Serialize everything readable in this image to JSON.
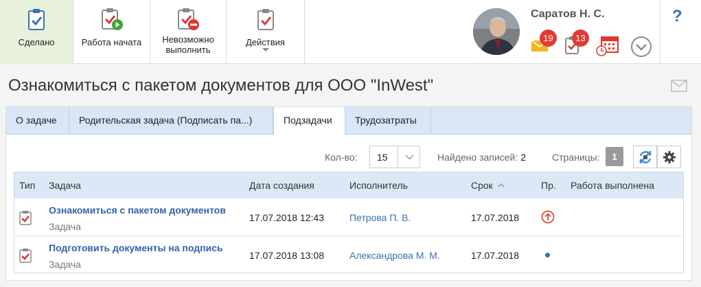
{
  "toolbar": {
    "done_label": "Сделано",
    "start_label": "Работа начата",
    "cannot_label_1": "Невозможно",
    "cannot_label_2": "выполнить",
    "actions_label": "Действия"
  },
  "user": {
    "name": "Саратов Н. С.",
    "mail_count": "19",
    "task_count": "13"
  },
  "help": "?",
  "page_title": "Ознакомиться с пакетом документов для ООО \"InWest\"",
  "tabs": [
    {
      "label": "О задаче"
    },
    {
      "label": "Родительская задача (Подписать па...)"
    },
    {
      "label": "Подзадачи"
    },
    {
      "label": "Трудозатраты"
    }
  ],
  "controls": {
    "count_label": "Кол-во:",
    "count_value": "15",
    "found_label": "Найдено записей:",
    "found_value": "2",
    "pages_label": "Страницы:",
    "page_value": "1"
  },
  "table": {
    "headers": {
      "type": "Тип",
      "task": "Задача",
      "created": "Дата создания",
      "executor": "Исполнитель",
      "due": "Срок",
      "priority": "Пр.",
      "work_done": "Работа выполнена"
    },
    "rows": [
      {
        "task": "Ознакомиться с пакетом документов",
        "type": "Задача",
        "created": "17.07.2018 12:43",
        "executor": "Петрова П. В.",
        "due": "17.07.2018",
        "priority": "high"
      },
      {
        "task": "Подготовить документы на подпись",
        "type": "Задача",
        "created": "17.07.2018 13:08",
        "executor": "Александрова М. М.",
        "due": "17.07.2018",
        "priority": "normal"
      }
    ]
  },
  "colors": {
    "accent_blue": "#3261ad",
    "badge_red": "#e13a34",
    "done_bg": "#e8f1dc",
    "tab_bg": "#d8e6f5"
  },
  "icons": {
    "done": "checklist-icon",
    "start": "checklist-play-icon",
    "cannot": "checklist-stop-icon",
    "actions": "checklist-icon",
    "mail": "mail-icon",
    "task": "task-icon",
    "calendar": "calendar-clock-icon",
    "more": "chevron-down-circle-icon",
    "refresh": "refresh-icon",
    "settings": "gear-icon",
    "priority_high": "arrow-up-circle-icon"
  }
}
